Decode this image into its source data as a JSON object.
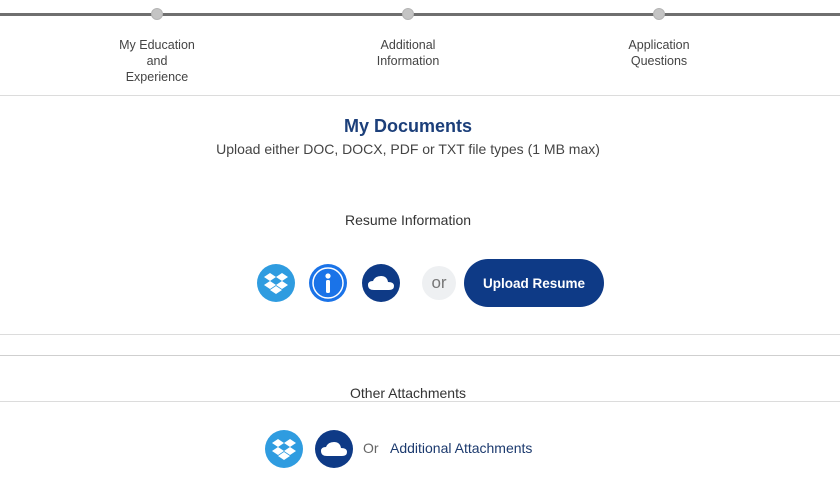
{
  "steps": [
    {
      "label": "My Education\nand\nExperience"
    },
    {
      "label": "Additional\nInformation"
    },
    {
      "label": "Application\nQuestions"
    }
  ],
  "documents": {
    "title": "My Documents",
    "subtitle": "Upload either DOC, DOCX, PDF or TXT file types (1 MB max)"
  },
  "resume": {
    "section_title": "Resume Information",
    "icons": [
      "dropbox-icon",
      "indeed-icon",
      "onedrive-icon"
    ],
    "or_label": "or",
    "upload_label": "Upload Resume"
  },
  "attachments": {
    "section_title": "Other Attachments",
    "icons": [
      "dropbox-icon",
      "onedrive-icon"
    ],
    "or_label": "Or",
    "link_label": "Additional Attachments"
  },
  "colors": {
    "brand_blue": "#0e3a86",
    "dropbox_blue": "#2f9ce0",
    "indeed_blue": "#1a73e8",
    "title_blue": "#1c3f7a"
  }
}
